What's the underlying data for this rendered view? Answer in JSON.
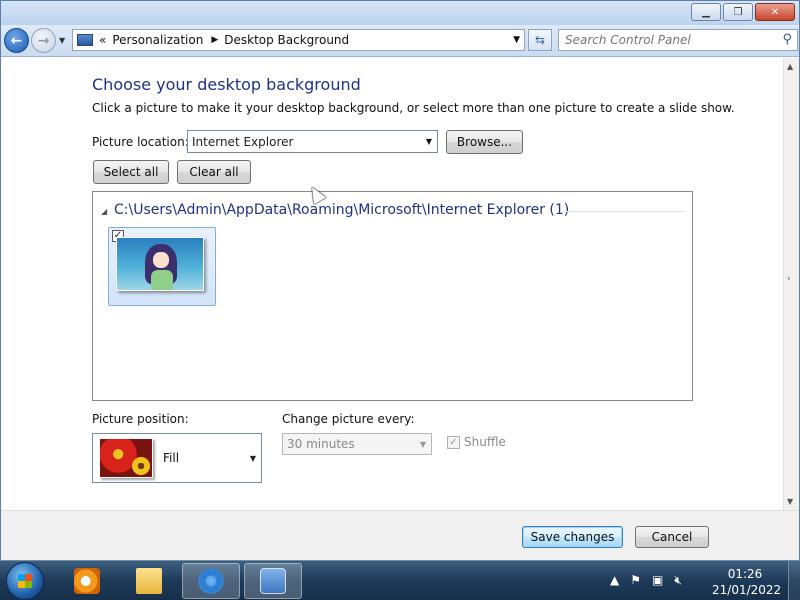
{
  "address": {
    "chevrons": "«",
    "crumbs": [
      "Personalization",
      "Desktop Background"
    ],
    "search_placeholder": "Search Control Panel"
  },
  "content": {
    "heading": "Choose your desktop background",
    "description": "Click a picture to make it your desktop background, or select more than one picture to create a slide show.",
    "picture_location_label": "Picture location:",
    "picture_location_value": "Internet Explorer",
    "browse_label": "Browse...",
    "select_all_label": "Select all",
    "clear_all_label": "Clear all",
    "group_title": "C:\\Users\\Admin\\AppData\\Roaming\\Microsoft\\Internet Explorer (1)",
    "picture_position_label": "Picture position:",
    "picture_position_value": "Fill",
    "change_picture_label": "Change picture every:",
    "change_picture_value": "30 minutes",
    "shuffle_label": "Shuffle"
  },
  "footer": {
    "save_label": "Save changes",
    "cancel_label": "Cancel"
  },
  "taskbar": {
    "time": "01:26",
    "date": "21/01/2022"
  },
  "icons": {
    "window_buttons": [
      "minimize-icon",
      "maximize-icon",
      "close-icon"
    ],
    "taskbar": [
      "start-orb-icon",
      "media-player-icon",
      "explorer-folder-icon",
      "internet-explorer-icon",
      "control-panel-icon"
    ],
    "tray": [
      "show-hidden-icons-icon",
      "action-center-flag-icon",
      "network-icon",
      "volume-muted-icon"
    ]
  }
}
